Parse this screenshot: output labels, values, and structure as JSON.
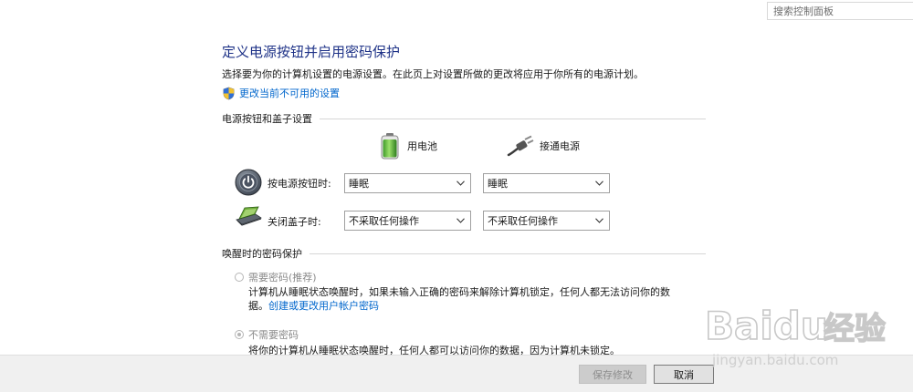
{
  "search": {
    "placeholder": "搜索控制面板"
  },
  "header": {
    "title": "定义电源按钮并启用密码保护",
    "description": "选择要为你的计算机设置的电源设置。在此页上对设置所做的更改将应用于你所有的电源计划。",
    "change_link": "更改当前不可用的设置"
  },
  "power_section": {
    "title": "电源按钮和盖子设置",
    "columns": {
      "battery": "用电池",
      "plugged": "接通电源"
    },
    "rows": [
      {
        "label": "按电源按钮时:",
        "icon": "power-button-icon",
        "battery_value": "睡眠",
        "plugged_value": "睡眠"
      },
      {
        "label": "关闭盖子时:",
        "icon": "laptop-lid-icon",
        "battery_value": "不采取任何操作",
        "plugged_value": "不采取任何操作"
      }
    ]
  },
  "password_section": {
    "title": "唤醒时的密码保护",
    "options": [
      {
        "label": "需要密码(推荐)",
        "selected": false,
        "description": "计算机从睡眠状态唤醒时，如果未输入正确的密码来解除计算机锁定，任何人都无法访问你的数",
        "description_cont": "据。",
        "link": "创建或更改用户帐户密码"
      },
      {
        "label": "不需要密码",
        "selected": true,
        "description": "将你的计算机从睡眠状态唤醒时，任何人都可以访问你的数据，因为计算机未锁定。"
      }
    ]
  },
  "footer": {
    "save_label": "保存修改",
    "cancel_label": "取消"
  },
  "watermark": {
    "brand": "Baidu",
    "brand_cn": "经验",
    "url": "jingyan.baidu.com"
  },
  "colors": {
    "title": "#1e3287",
    "link": "#0066cc",
    "footer_bg": "#f0f0f0"
  }
}
